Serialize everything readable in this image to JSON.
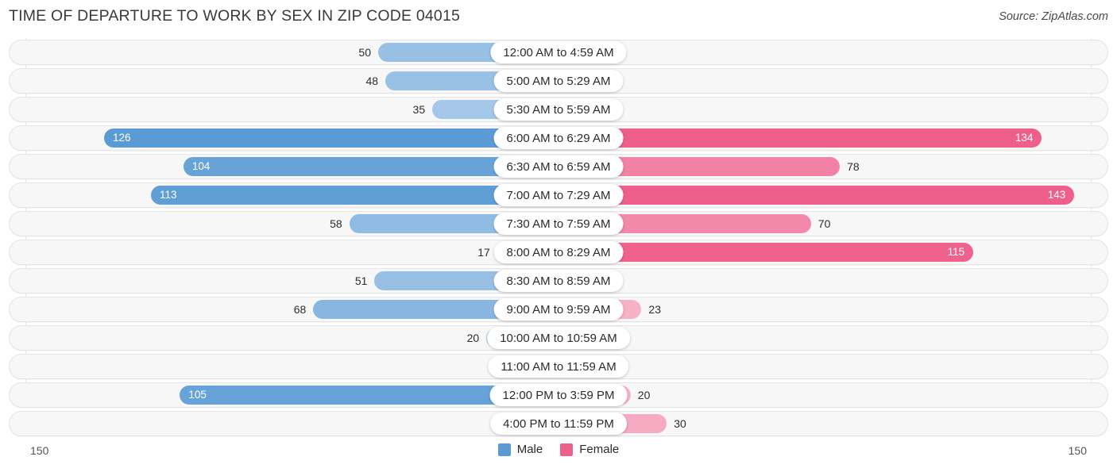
{
  "header": {
    "title": "TIME OF DEPARTURE TO WORK BY SEX IN ZIP CODE 04015",
    "source": "Source: ZipAtlas.com"
  },
  "legend": {
    "male_label": "Male",
    "female_label": "Female",
    "male_color": "#5b9bd5",
    "female_color": "#ef5f8c"
  },
  "axis": {
    "left_max": "150",
    "right_max": "150"
  },
  "chart_data": {
    "type": "bar",
    "orientation": "horizontal-diverging",
    "title": "TIME OF DEPARTURE TO WORK BY SEX IN ZIP CODE 04015",
    "xlabel": "",
    "ylabel": "",
    "xlim": [
      150,
      150
    ],
    "grid": true,
    "legend_position": "bottom-center",
    "categories": [
      "12:00 AM to 4:59 AM",
      "5:00 AM to 5:29 AM",
      "5:30 AM to 5:59 AM",
      "6:00 AM to 6:29 AM",
      "6:30 AM to 6:59 AM",
      "7:00 AM to 7:29 AM",
      "7:30 AM to 7:59 AM",
      "8:00 AM to 8:29 AM",
      "8:30 AM to 8:59 AM",
      "9:00 AM to 9:59 AM",
      "10:00 AM to 10:59 AM",
      "11:00 AM to 11:59 AM",
      "12:00 PM to 3:59 PM",
      "4:00 PM to 11:59 PM"
    ],
    "series": [
      {
        "name": "Male",
        "values": [
          50,
          48,
          35,
          126,
          104,
          113,
          58,
          17,
          51,
          68,
          20,
          0,
          105,
          12
        ]
      },
      {
        "name": "Female",
        "values": [
          0,
          0,
          0,
          134,
          78,
          143,
          70,
          115,
          5,
          23,
          10,
          0,
          20,
          30
        ]
      }
    ]
  },
  "rows": [
    {
      "category": "12:00 AM to 4:59 AM",
      "male": "50",
      "female": "0"
    },
    {
      "category": "5:00 AM to 5:29 AM",
      "male": "48",
      "female": "0"
    },
    {
      "category": "5:30 AM to 5:59 AM",
      "male": "35",
      "female": "0"
    },
    {
      "category": "6:00 AM to 6:29 AM",
      "male": "126",
      "female": "134"
    },
    {
      "category": "6:30 AM to 6:59 AM",
      "male": "104",
      "female": "78"
    },
    {
      "category": "7:00 AM to 7:29 AM",
      "male": "113",
      "female": "143"
    },
    {
      "category": "7:30 AM to 7:59 AM",
      "male": "58",
      "female": "70"
    },
    {
      "category": "8:00 AM to 8:29 AM",
      "male": "17",
      "female": "115"
    },
    {
      "category": "8:30 AM to 8:59 AM",
      "male": "51",
      "female": "5"
    },
    {
      "category": "9:00 AM to 9:59 AM",
      "male": "68",
      "female": "23"
    },
    {
      "category": "10:00 AM to 10:59 AM",
      "male": "20",
      "female": "10"
    },
    {
      "category": "11:00 AM to 11:59 AM",
      "male": "0",
      "female": "0"
    },
    {
      "category": "12:00 PM to 3:59 PM",
      "male": "105",
      "female": "20"
    },
    {
      "category": "4:00 PM to 11:59 PM",
      "male": "12",
      "female": "30"
    }
  ]
}
